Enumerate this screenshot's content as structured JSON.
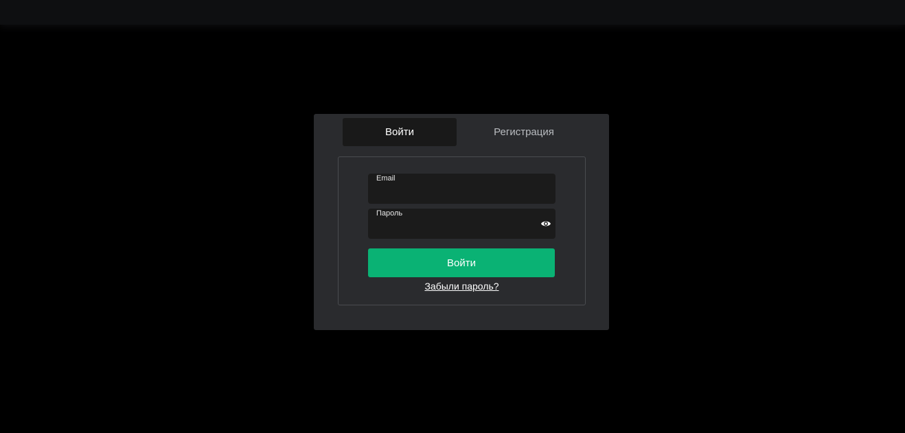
{
  "tabs": {
    "login_label": "Войти",
    "register_label": "Регистрация",
    "active": "login"
  },
  "form": {
    "email_label": "Email",
    "email_value": "",
    "password_label": "Пароль",
    "password_value": "",
    "password_toggle_icon": "eye-icon",
    "submit_label": "Войти",
    "forgot_label": "Забыли пароль?"
  },
  "colors": {
    "page_background": "#000000",
    "modal_background": "#2a2b2e",
    "active_tab_background": "#191919",
    "field_background": "#1b1b1b",
    "accent": "#0ab274"
  }
}
